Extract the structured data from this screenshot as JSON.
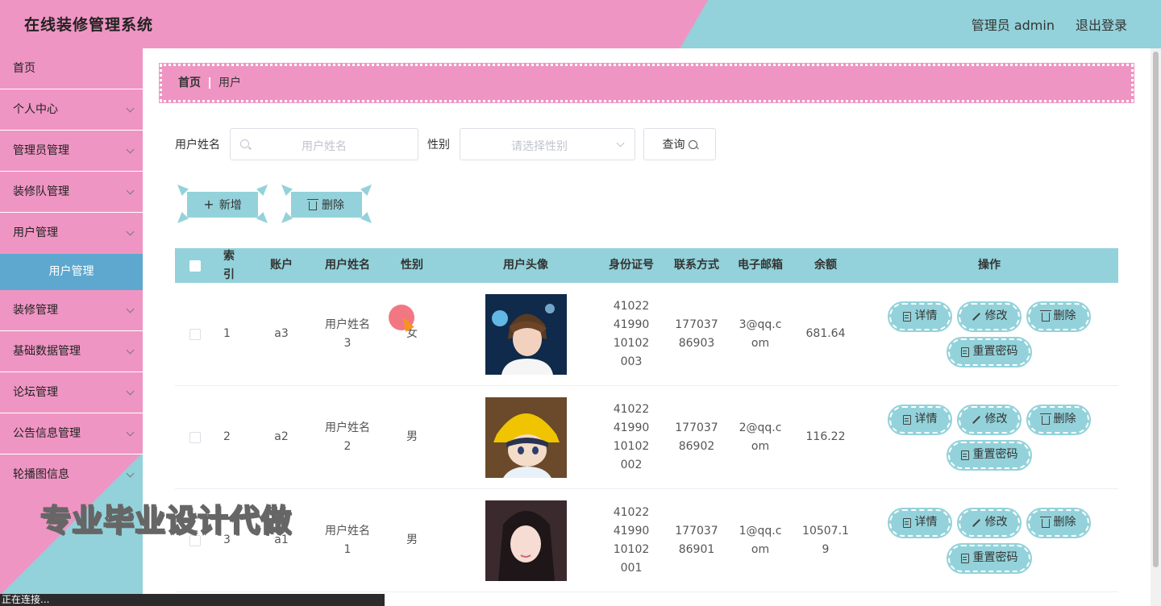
{
  "header": {
    "title": "在线装修管理系统",
    "admin_label": "管理员 admin",
    "logout": "退出登录"
  },
  "sidebar": {
    "items": [
      {
        "label": "首页"
      },
      {
        "label": "个人中心"
      },
      {
        "label": "管理员管理"
      },
      {
        "label": "装修队管理"
      },
      {
        "label": "用户管理"
      },
      {
        "label": "装修管理"
      },
      {
        "label": "基础数据管理"
      },
      {
        "label": "论坛管理"
      },
      {
        "label": "公告信息管理"
      },
      {
        "label": "轮播图信息"
      }
    ],
    "active_sub": "用户管理"
  },
  "breadcrumb": {
    "home": "首页",
    "current": "用户"
  },
  "search": {
    "name_label": "用户姓名",
    "name_placeholder": "用户姓名",
    "gender_label": "性别",
    "gender_placeholder": "请选择性别",
    "query_button": "查询"
  },
  "actions": {
    "add": "新增",
    "delete": "删除"
  },
  "table": {
    "headers": [
      "索引",
      "账户",
      "用户姓名",
      "性别",
      "用户头像",
      "身份证号",
      "联系方式",
      "电子邮箱",
      "余额",
      "操作"
    ],
    "rows": [
      {
        "index": "1",
        "account": "a3",
        "name": "用户姓名3",
        "gender": "女",
        "id": "410224199010102003",
        "phone": "17703786903",
        "email": "3@qq.com",
        "balance": "681.64",
        "avatar": "avatar-boy-portrait"
      },
      {
        "index": "2",
        "account": "a2",
        "name": "用户姓名2",
        "gender": "男",
        "id": "410224199010102002",
        "phone": "17703786902",
        "email": "2@qq.com",
        "balance": "116.22",
        "avatar": "avatar-cartoon-yellow-hat"
      },
      {
        "index": "3",
        "account": "a1",
        "name": "用户姓名1",
        "gender": "男",
        "id": "410224199010102001",
        "phone": "17703786901",
        "email": "1@qq.com",
        "balance": "10507.19",
        "avatar": "avatar-girl-portrait"
      }
    ],
    "ops": {
      "detail": "详情",
      "edit": "修改",
      "delete": "删除",
      "reset": "重置密码"
    }
  },
  "overlay": {
    "watermark": "专业毕业设计代做",
    "status": "正在连接..."
  },
  "colors": {
    "pink": "#ef95c3",
    "teal": "#93d2da",
    "active_blue": "#5ea8cf"
  }
}
